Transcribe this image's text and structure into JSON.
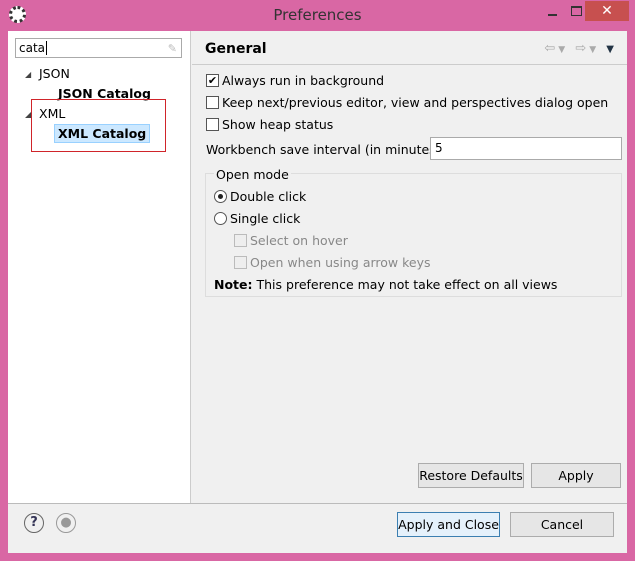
{
  "window": {
    "title": "Preferences",
    "close": "✕"
  },
  "left": {
    "filter_value": "cata",
    "tree": [
      {
        "label": "JSON",
        "children": [
          "JSON Catalog"
        ]
      },
      {
        "label": "XML",
        "children": [
          "XML Catalog"
        ]
      }
    ]
  },
  "page": {
    "title": "General",
    "always_run": "Always run in background",
    "always_run_checked": true,
    "keep_dialog": "Keep next/previous editor, view and perspectives dialog open",
    "keep_dialog_checked": false,
    "heap": "Show heap status",
    "heap_checked": false,
    "save_interval_label": "Workbench save interval (in minutes):",
    "save_interval_value": "5",
    "open_mode": {
      "title": "Open mode",
      "double": "Double click",
      "single": "Single click",
      "selected": "Double click",
      "hover": "Select on hover",
      "arrow": "Open when using arrow keys"
    },
    "note_label": "Note:",
    "note_text": "This preference may not take effect on all views",
    "restore": "Restore Defaults",
    "apply": "Apply"
  },
  "footer": {
    "apply_close": "Apply and Close",
    "cancel": "Cancel"
  },
  "colors": {
    "frame": "#d967a4",
    "highlight_box": "#d0242a",
    "selection": "#cce8ff"
  }
}
